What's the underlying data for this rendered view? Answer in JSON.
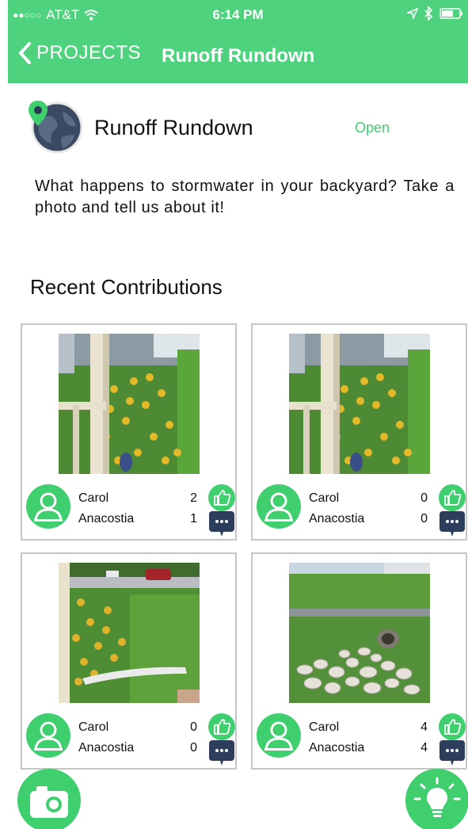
{
  "status_bar": {
    "carrier": "AT&T",
    "time": "6:14 PM",
    "signal_icon": "signal-dots-icon",
    "wifi_icon": "wifi-icon",
    "location_icon": "location-arrow-icon",
    "bluetooth_icon": "bluetooth-icon",
    "battery_icon": "battery-icon"
  },
  "nav": {
    "back_label": "PROJECTS",
    "title": "Runoff Rundown"
  },
  "project": {
    "name": "Runoff Rundown",
    "status": "Open",
    "description": "What happens to stormwater in your backyard? Take a photo and tell us about it!"
  },
  "contributions": {
    "title": "Recent Contributions",
    "items": [
      {
        "user": "Carol",
        "org": "Anacostia",
        "likes": "2",
        "comments": "1",
        "photo": "garden-flowers-photo"
      },
      {
        "user": "Carol",
        "org": "Anacostia",
        "likes": "0",
        "comments": "0",
        "photo": "garden-flowers-photo"
      },
      {
        "user": "Carol",
        "org": "Anacostia",
        "likes": "0",
        "comments": "0",
        "photo": "downspout-yard-photo"
      },
      {
        "user": "Carol",
        "org": "Anacostia",
        "likes": "4",
        "comments": "4",
        "photo": "drainage-pipe-photo"
      }
    ]
  },
  "colors": {
    "brand_green": "#4fd27d",
    "accent_green": "#3fcf6f",
    "comment_navy": "#2c3e5c",
    "card_border": "#c5c5c5"
  },
  "actions": {
    "camera_icon": "camera-icon",
    "idea_icon": "lightbulb-icon"
  }
}
